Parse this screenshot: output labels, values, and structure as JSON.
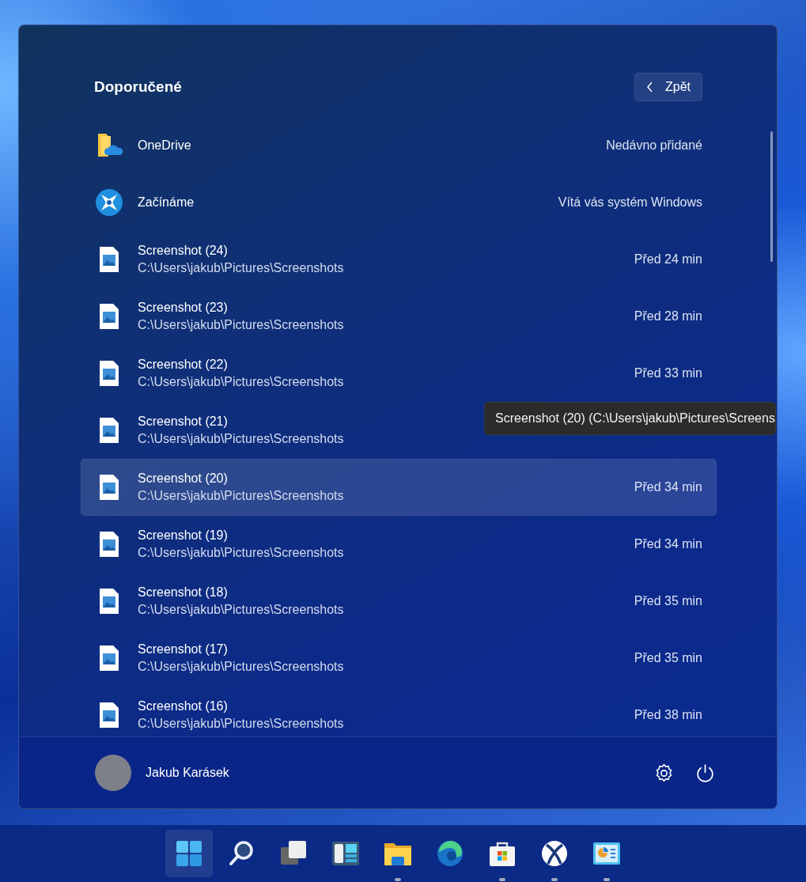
{
  "start_menu": {
    "title": "Doporučené",
    "back_button": {
      "label": "Zpět"
    },
    "items": [
      {
        "kind": "onedrive",
        "name": "OneDrive",
        "detail": "Nedávno přidané",
        "selected": false
      },
      {
        "kind": "get-started",
        "name": "Začínáme",
        "detail": "Vítá vás systém Windows",
        "selected": false
      },
      {
        "kind": "image-file",
        "name": "Screenshot (24)",
        "path": "C:\\Users\\jakub\\Pictures\\Screenshots",
        "detail": "Před 24 min",
        "selected": false
      },
      {
        "kind": "image-file",
        "name": "Screenshot (23)",
        "path": "C:\\Users\\jakub\\Pictures\\Screenshots",
        "detail": "Před 28 min",
        "selected": false
      },
      {
        "kind": "image-file",
        "name": "Screenshot (22)",
        "path": "C:\\Users\\jakub\\Pictures\\Screenshots",
        "detail": "Před 33 min",
        "selected": false
      },
      {
        "kind": "image-file",
        "name": "Screenshot (21)",
        "path": "C:\\Users\\jakub\\Pictures\\Screenshots",
        "selected": false
      },
      {
        "kind": "image-file",
        "name": "Screenshot (20)",
        "path": "C:\\Users\\jakub\\Pictures\\Screenshots",
        "detail": "Před 34 min",
        "selected": true
      },
      {
        "kind": "image-file",
        "name": "Screenshot (19)",
        "path": "C:\\Users\\jakub\\Pictures\\Screenshots",
        "detail": "Před 34 min",
        "selected": false
      },
      {
        "kind": "image-file",
        "name": "Screenshot (18)",
        "path": "C:\\Users\\jakub\\Pictures\\Screenshots",
        "detail": "Před 35 min",
        "selected": false
      },
      {
        "kind": "image-file",
        "name": "Screenshot (17)",
        "path": "C:\\Users\\jakub\\Pictures\\Screenshots",
        "detail": "Před 35 min",
        "selected": false
      },
      {
        "kind": "image-file",
        "name": "Screenshot (16)",
        "path": "C:\\Users\\jakub\\Pictures\\Screenshots",
        "detail": "Před 38 min",
        "selected": false
      }
    ],
    "tooltip": "Screenshot (20) (C:\\Users\\jakub\\Pictures\\Screens",
    "user": {
      "name": "Jakub Karásek"
    }
  },
  "taskbar": {
    "items": [
      {
        "kind": "start",
        "selected": true,
        "running": false
      },
      {
        "kind": "search",
        "selected": false,
        "running": false
      },
      {
        "kind": "task-view",
        "selected": false,
        "running": false
      },
      {
        "kind": "widgets",
        "selected": false,
        "running": false
      },
      {
        "kind": "folder",
        "selected": false,
        "running": true
      },
      {
        "kind": "browser",
        "selected": false,
        "running": false
      },
      {
        "kind": "store",
        "selected": false,
        "running": true
      },
      {
        "kind": "xbox",
        "selected": false,
        "running": true
      },
      {
        "kind": "control-panel",
        "selected": false,
        "running": true
      }
    ]
  }
}
